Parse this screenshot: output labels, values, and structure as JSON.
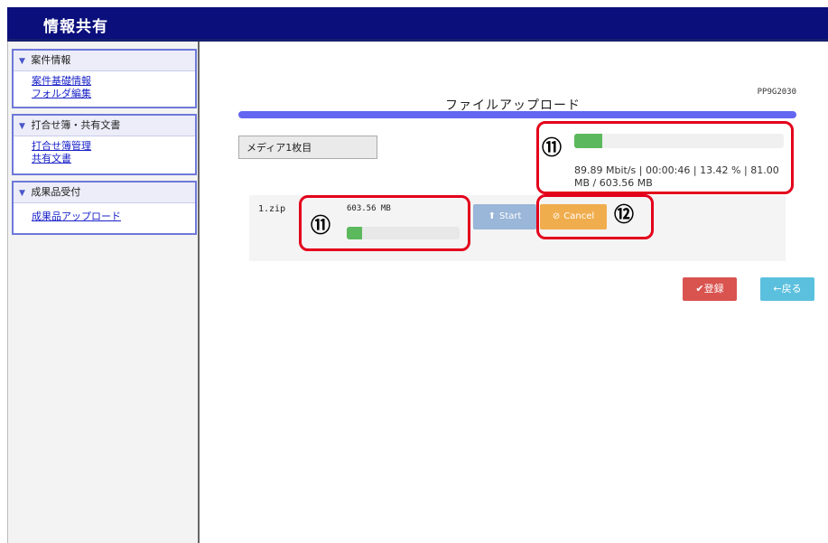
{
  "app": {
    "title": "情報共有"
  },
  "sidebar": {
    "sections": [
      {
        "label": "案件情報",
        "items": [
          {
            "label": "案件基礎情報"
          },
          {
            "label": "フォルダ編集"
          }
        ]
      },
      {
        "label": "打合せ簿・共有文書",
        "items": [
          {
            "label": "打合せ簿管理"
          },
          {
            "label": "共有文書"
          }
        ]
      },
      {
        "label": "成果品受付",
        "items": [
          {
            "label": "成果品アップロード"
          }
        ]
      }
    ]
  },
  "main": {
    "screen_id": "PP9G2030",
    "page_title": "ファイルアップロード",
    "media_label": "メディア1枚目",
    "overall_progress": {
      "percent": 13.42,
      "status_text": "89.89 Mbit/s | 00:00:46 | 13.42 % | 81.00 MB / 603.56 MB"
    },
    "file": {
      "name": "1.zip",
      "size": "603.56 MB",
      "progress_percent": 13.42,
      "start_label": "Start",
      "cancel_label": "Cancel"
    },
    "buttons": {
      "register_label": "登録",
      "back_label": "戻る"
    },
    "callouts": [
      "⑪",
      "⑪",
      "⑫"
    ]
  },
  "colors": {
    "header": "#0a0f7c",
    "accent_bar": "#6366f0",
    "progress": "#5cb85c",
    "cancel": "#f0ad4e",
    "register": "#d9534f",
    "back": "#5bc0de",
    "callout": "#e3001b"
  },
  "icons": {
    "start": "upload-circle-icon",
    "cancel": "ban-icon",
    "register": "check-icon",
    "back": "arrow-left-icon",
    "section": "chevron-down-icon"
  }
}
